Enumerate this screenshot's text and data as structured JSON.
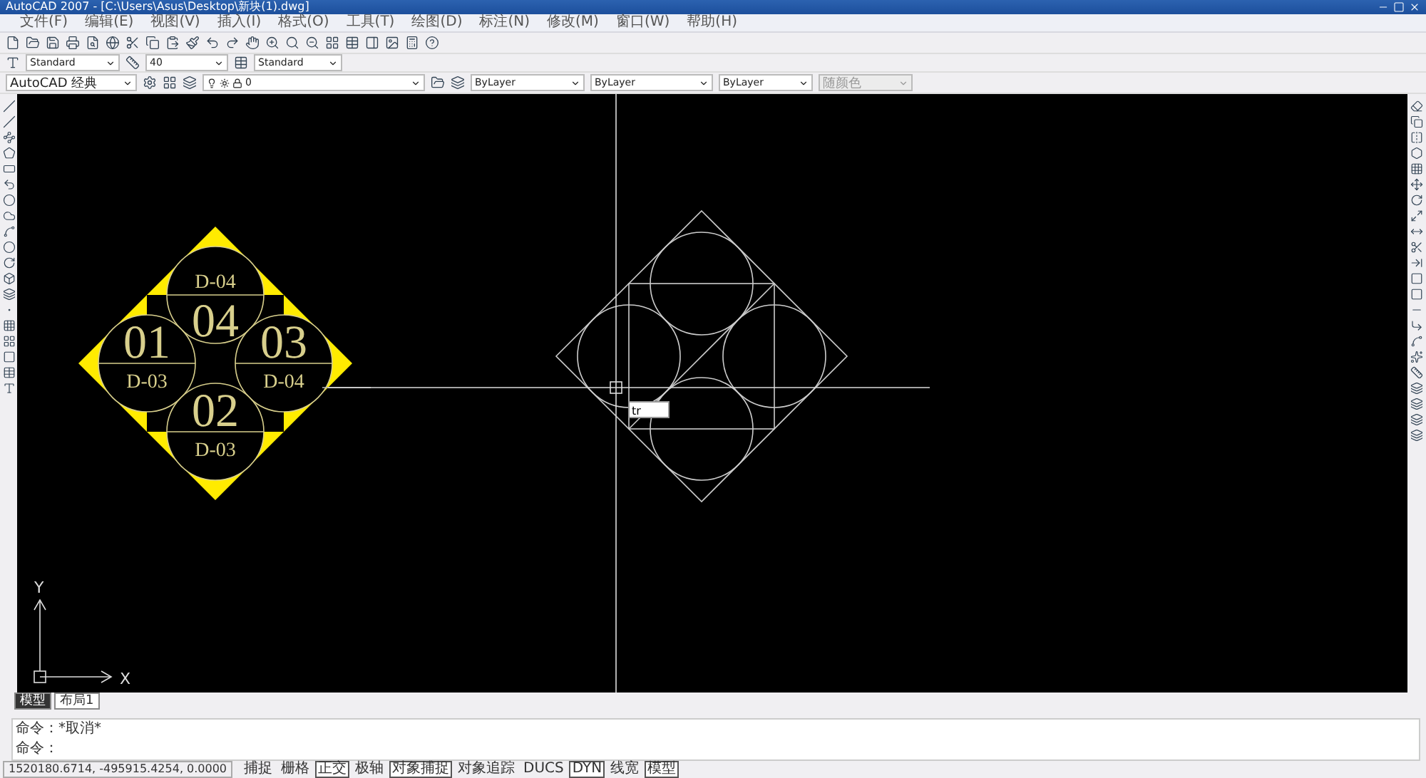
{
  "window": {
    "title": "AutoCAD 2007 - [C:\\Users\\Asus\\Desktop\\新块(1).dwg]"
  },
  "menu": [
    "文件(F)",
    "编辑(E)",
    "视图(V)",
    "插入(I)",
    "格式(O)",
    "工具(T)",
    "绘图(D)",
    "标注(N)",
    "修改(M)",
    "窗口(W)",
    "帮助(H)"
  ],
  "styles_toolbar": {
    "text_style": "Standard",
    "dim_style": "40",
    "table_style": "Standard"
  },
  "layers_toolbar": {
    "workspace": "AutoCAD 经典",
    "layer": "0",
    "color_control": "ByLayer",
    "linetype": "ByLayer",
    "lineweight": "ByLayer",
    "plot_style": {
      "value": "随颜色",
      "disabled": true
    }
  },
  "drawing": {
    "block_cells": [
      {
        "number": "04",
        "code": "D-04"
      },
      {
        "number": "01",
        "code": "D-03"
      },
      {
        "number": "03",
        "code": "D-04"
      },
      {
        "number": "02",
        "code": "D-03"
      }
    ],
    "dynamic_input": "tr",
    "ucs": {
      "x": "X",
      "y": "Y"
    }
  },
  "layout_tabs": [
    {
      "label": "模型",
      "selected": true
    },
    {
      "label": "布局1",
      "selected": false
    }
  ],
  "command_lines": [
    "命令：*取消*",
    "命令："
  ],
  "status_bar": {
    "coordinates": "1520180.6714, -495915.4254, 0.0000",
    "toggles": [
      {
        "label": "捕捉",
        "on": false
      },
      {
        "label": "栅格",
        "on": false
      },
      {
        "label": "正交",
        "on": true
      },
      {
        "label": "极轴",
        "on": false
      },
      {
        "label": "对象捕捉",
        "on": true
      },
      {
        "label": "对象追踪",
        "on": false
      },
      {
        "label": "DUCS",
        "on": false
      },
      {
        "label": "DYN",
        "on": true
      },
      {
        "label": "线宽",
        "on": false
      },
      {
        "label": "模型",
        "on": true
      }
    ]
  }
}
